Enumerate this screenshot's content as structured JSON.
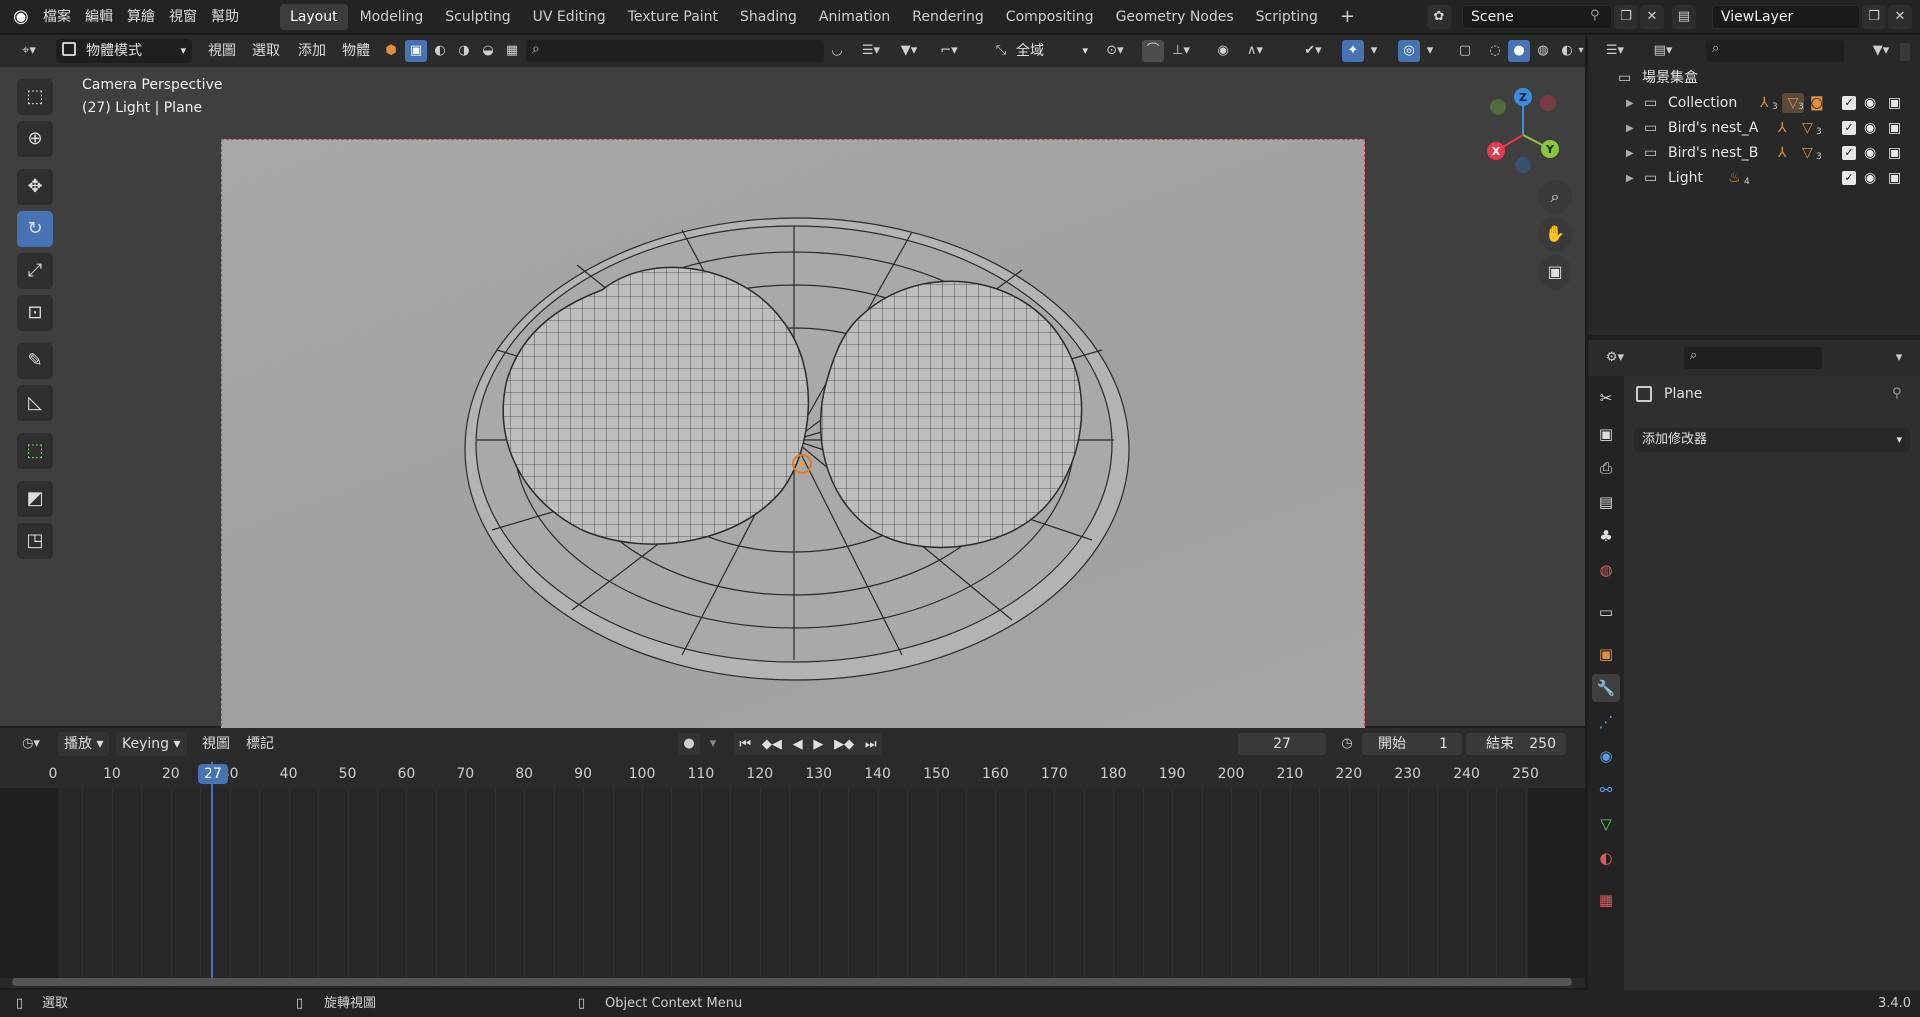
{
  "topbar": {
    "menus": [
      "檔案",
      "編輯",
      "算繪",
      "視窗",
      "幫助"
    ],
    "workspaces": [
      "Layout",
      "Modeling",
      "Sculpting",
      "UV Editing",
      "Texture Paint",
      "Shading",
      "Animation",
      "Rendering",
      "Compositing",
      "Geometry Nodes",
      "Scripting"
    ],
    "active_workspace": "Layout",
    "scene": "Scene",
    "view_layer": "ViewLayer"
  },
  "viewport_header": {
    "mode": "物體模式",
    "menus": [
      "視圖",
      "選取",
      "添加",
      "物體"
    ],
    "transform_orientation": "全域"
  },
  "viewport": {
    "title": "Camera Perspective",
    "subtitle": "(27) Light | Plane",
    "gizmo_axes": {
      "x": "X",
      "y": "Y",
      "z": "Z"
    }
  },
  "outliner": {
    "root": "場景集盒",
    "items": [
      {
        "name": "Collection",
        "badge_a": "3",
        "badge_b": "3"
      },
      {
        "name": "Bird's nest_A",
        "badge_a": "",
        "badge_b": "3"
      },
      {
        "name": "Bird's nest_B",
        "badge_a": "",
        "badge_b": "3"
      },
      {
        "name": "Light",
        "badge_a": "4",
        "badge_b": ""
      }
    ]
  },
  "properties": {
    "object_name": "Plane",
    "add_modifier": "添加修改器"
  },
  "timeline": {
    "menus": [
      "播放",
      "Keying",
      "視圖",
      "標記"
    ],
    "current_frame": "27",
    "start_label": "開始",
    "start": "1",
    "end_label": "結束",
    "end": "250",
    "ticks": [
      "0",
      "10",
      "20",
      "30",
      "40",
      "50",
      "60",
      "70",
      "80",
      "90",
      "100",
      "110",
      "120",
      "130",
      "140",
      "150",
      "160",
      "170",
      "180",
      "190",
      "200",
      "210",
      "220",
      "230",
      "240",
      "250"
    ]
  },
  "statusbar": {
    "select": "選取",
    "rotate": "旋轉視圖",
    "context": "Object Context Menu",
    "version": "3.4.0"
  },
  "colors": {
    "accent": "#4772b3",
    "axis_x": "#e53a4f",
    "axis_y": "#8bc53f",
    "axis_z": "#3b8de0",
    "object_orange": "#e08f3a"
  }
}
